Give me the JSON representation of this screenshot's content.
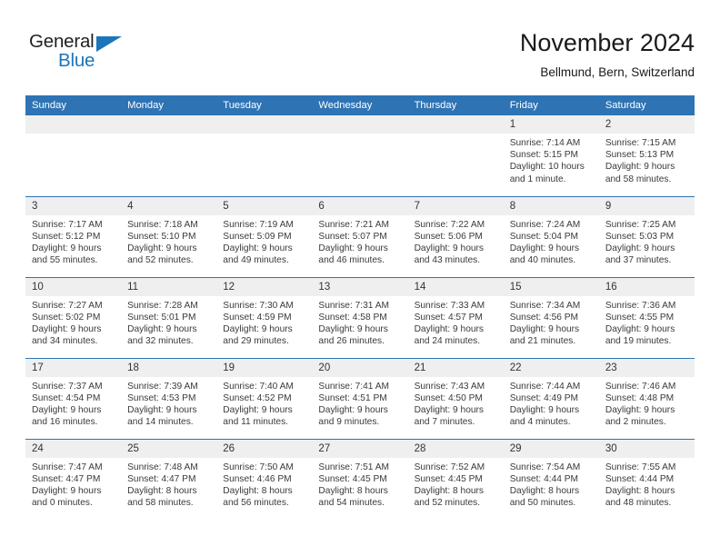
{
  "logo": {
    "word_top": "General",
    "word_bottom": "Blue",
    "triangle_color": "#1b75bb",
    "text_color": "#231f20"
  },
  "header": {
    "title": "November 2024",
    "subtitle": "Bellmund, Bern, Switzerland"
  },
  "theme": {
    "header_blue": "#2e74b5",
    "daynum_band": "#efefef",
    "text": "#333333"
  },
  "weekdays": [
    "Sunday",
    "Monday",
    "Tuesday",
    "Wednesday",
    "Thursday",
    "Friday",
    "Saturday"
  ],
  "weeks": [
    [
      {
        "day": "",
        "sunrise": "",
        "sunset": "",
        "daylight_1": "",
        "daylight_2": ""
      },
      {
        "day": "",
        "sunrise": "",
        "sunset": "",
        "daylight_1": "",
        "daylight_2": ""
      },
      {
        "day": "",
        "sunrise": "",
        "sunset": "",
        "daylight_1": "",
        "daylight_2": ""
      },
      {
        "day": "",
        "sunrise": "",
        "sunset": "",
        "daylight_1": "",
        "daylight_2": ""
      },
      {
        "day": "",
        "sunrise": "",
        "sunset": "",
        "daylight_1": "",
        "daylight_2": ""
      },
      {
        "day": "1",
        "sunrise": "Sunrise: 7:14 AM",
        "sunset": "Sunset: 5:15 PM",
        "daylight_1": "Daylight: 10 hours",
        "daylight_2": "and 1 minute."
      },
      {
        "day": "2",
        "sunrise": "Sunrise: 7:15 AM",
        "sunset": "Sunset: 5:13 PM",
        "daylight_1": "Daylight: 9 hours",
        "daylight_2": "and 58 minutes."
      }
    ],
    [
      {
        "day": "3",
        "sunrise": "Sunrise: 7:17 AM",
        "sunset": "Sunset: 5:12 PM",
        "daylight_1": "Daylight: 9 hours",
        "daylight_2": "and 55 minutes."
      },
      {
        "day": "4",
        "sunrise": "Sunrise: 7:18 AM",
        "sunset": "Sunset: 5:10 PM",
        "daylight_1": "Daylight: 9 hours",
        "daylight_2": "and 52 minutes."
      },
      {
        "day": "5",
        "sunrise": "Sunrise: 7:19 AM",
        "sunset": "Sunset: 5:09 PM",
        "daylight_1": "Daylight: 9 hours",
        "daylight_2": "and 49 minutes."
      },
      {
        "day": "6",
        "sunrise": "Sunrise: 7:21 AM",
        "sunset": "Sunset: 5:07 PM",
        "daylight_1": "Daylight: 9 hours",
        "daylight_2": "and 46 minutes."
      },
      {
        "day": "7",
        "sunrise": "Sunrise: 7:22 AM",
        "sunset": "Sunset: 5:06 PM",
        "daylight_1": "Daylight: 9 hours",
        "daylight_2": "and 43 minutes."
      },
      {
        "day": "8",
        "sunrise": "Sunrise: 7:24 AM",
        "sunset": "Sunset: 5:04 PM",
        "daylight_1": "Daylight: 9 hours",
        "daylight_2": "and 40 minutes."
      },
      {
        "day": "9",
        "sunrise": "Sunrise: 7:25 AM",
        "sunset": "Sunset: 5:03 PM",
        "daylight_1": "Daylight: 9 hours",
        "daylight_2": "and 37 minutes."
      }
    ],
    [
      {
        "day": "10",
        "sunrise": "Sunrise: 7:27 AM",
        "sunset": "Sunset: 5:02 PM",
        "daylight_1": "Daylight: 9 hours",
        "daylight_2": "and 34 minutes."
      },
      {
        "day": "11",
        "sunrise": "Sunrise: 7:28 AM",
        "sunset": "Sunset: 5:01 PM",
        "daylight_1": "Daylight: 9 hours",
        "daylight_2": "and 32 minutes."
      },
      {
        "day": "12",
        "sunrise": "Sunrise: 7:30 AM",
        "sunset": "Sunset: 4:59 PM",
        "daylight_1": "Daylight: 9 hours",
        "daylight_2": "and 29 minutes."
      },
      {
        "day": "13",
        "sunrise": "Sunrise: 7:31 AM",
        "sunset": "Sunset: 4:58 PM",
        "daylight_1": "Daylight: 9 hours",
        "daylight_2": "and 26 minutes."
      },
      {
        "day": "14",
        "sunrise": "Sunrise: 7:33 AM",
        "sunset": "Sunset: 4:57 PM",
        "daylight_1": "Daylight: 9 hours",
        "daylight_2": "and 24 minutes."
      },
      {
        "day": "15",
        "sunrise": "Sunrise: 7:34 AM",
        "sunset": "Sunset: 4:56 PM",
        "daylight_1": "Daylight: 9 hours",
        "daylight_2": "and 21 minutes."
      },
      {
        "day": "16",
        "sunrise": "Sunrise: 7:36 AM",
        "sunset": "Sunset: 4:55 PM",
        "daylight_1": "Daylight: 9 hours",
        "daylight_2": "and 19 minutes."
      }
    ],
    [
      {
        "day": "17",
        "sunrise": "Sunrise: 7:37 AM",
        "sunset": "Sunset: 4:54 PM",
        "daylight_1": "Daylight: 9 hours",
        "daylight_2": "and 16 minutes."
      },
      {
        "day": "18",
        "sunrise": "Sunrise: 7:39 AM",
        "sunset": "Sunset: 4:53 PM",
        "daylight_1": "Daylight: 9 hours",
        "daylight_2": "and 14 minutes."
      },
      {
        "day": "19",
        "sunrise": "Sunrise: 7:40 AM",
        "sunset": "Sunset: 4:52 PM",
        "daylight_1": "Daylight: 9 hours",
        "daylight_2": "and 11 minutes."
      },
      {
        "day": "20",
        "sunrise": "Sunrise: 7:41 AM",
        "sunset": "Sunset: 4:51 PM",
        "daylight_1": "Daylight: 9 hours",
        "daylight_2": "and 9 minutes."
      },
      {
        "day": "21",
        "sunrise": "Sunrise: 7:43 AM",
        "sunset": "Sunset: 4:50 PM",
        "daylight_1": "Daylight: 9 hours",
        "daylight_2": "and 7 minutes."
      },
      {
        "day": "22",
        "sunrise": "Sunrise: 7:44 AM",
        "sunset": "Sunset: 4:49 PM",
        "daylight_1": "Daylight: 9 hours",
        "daylight_2": "and 4 minutes."
      },
      {
        "day": "23",
        "sunrise": "Sunrise: 7:46 AM",
        "sunset": "Sunset: 4:48 PM",
        "daylight_1": "Daylight: 9 hours",
        "daylight_2": "and 2 minutes."
      }
    ],
    [
      {
        "day": "24",
        "sunrise": "Sunrise: 7:47 AM",
        "sunset": "Sunset: 4:47 PM",
        "daylight_1": "Daylight: 9 hours",
        "daylight_2": "and 0 minutes."
      },
      {
        "day": "25",
        "sunrise": "Sunrise: 7:48 AM",
        "sunset": "Sunset: 4:47 PM",
        "daylight_1": "Daylight: 8 hours",
        "daylight_2": "and 58 minutes."
      },
      {
        "day": "26",
        "sunrise": "Sunrise: 7:50 AM",
        "sunset": "Sunset: 4:46 PM",
        "daylight_1": "Daylight: 8 hours",
        "daylight_2": "and 56 minutes."
      },
      {
        "day": "27",
        "sunrise": "Sunrise: 7:51 AM",
        "sunset": "Sunset: 4:45 PM",
        "daylight_1": "Daylight: 8 hours",
        "daylight_2": "and 54 minutes."
      },
      {
        "day": "28",
        "sunrise": "Sunrise: 7:52 AM",
        "sunset": "Sunset: 4:45 PM",
        "daylight_1": "Daylight: 8 hours",
        "daylight_2": "and 52 minutes."
      },
      {
        "day": "29",
        "sunrise": "Sunrise: 7:54 AM",
        "sunset": "Sunset: 4:44 PM",
        "daylight_1": "Daylight: 8 hours",
        "daylight_2": "and 50 minutes."
      },
      {
        "day": "30",
        "sunrise": "Sunrise: 7:55 AM",
        "sunset": "Sunset: 4:44 PM",
        "daylight_1": "Daylight: 8 hours",
        "daylight_2": "and 48 minutes."
      }
    ]
  ]
}
